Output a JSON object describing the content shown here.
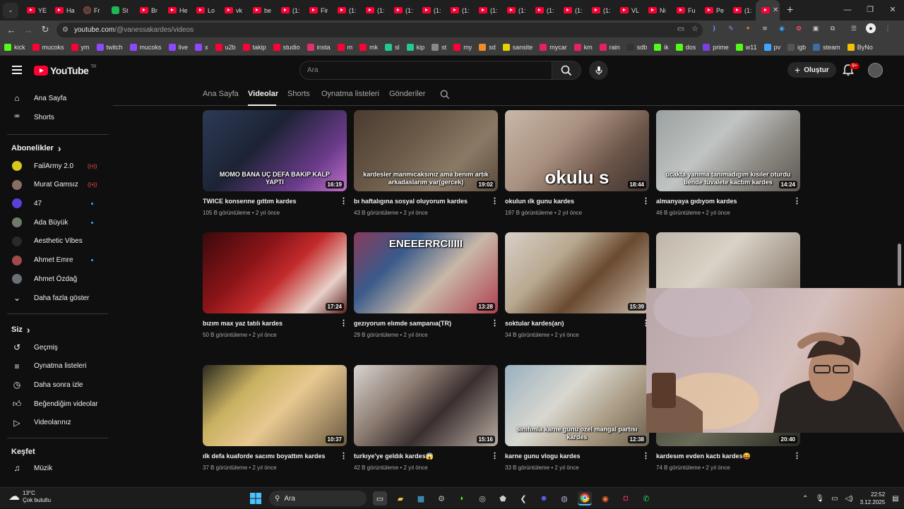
{
  "browser": {
    "tabs": [
      {
        "label": "YE",
        "icon": "youtube-favicon"
      },
      {
        "label": "Ha",
        "icon": "youtube-favicon"
      },
      {
        "label": "Fr",
        "icon": "channel-favicon"
      },
      {
        "label": "St",
        "icon": "kick-favicon"
      },
      {
        "label": "Br",
        "icon": "youtube-favicon"
      },
      {
        "label": "He",
        "icon": "youtube-favicon"
      },
      {
        "label": "Lo",
        "icon": "youtube-favicon"
      },
      {
        "label": "vk",
        "icon": "youtube-favicon"
      },
      {
        "label": "be",
        "icon": "youtube-favicon"
      },
      {
        "label": "(1:",
        "icon": "youtube-favicon"
      },
      {
        "label": "Fir",
        "icon": "youtube-favicon"
      },
      {
        "label": "(1:",
        "icon": "youtube-favicon"
      },
      {
        "label": "(1:",
        "icon": "youtube-favicon"
      },
      {
        "label": "(1:",
        "icon": "youtube-favicon"
      },
      {
        "label": "(1:",
        "icon": "youtube-favicon"
      },
      {
        "label": "(1:",
        "icon": "youtube-favicon"
      },
      {
        "label": "(1:",
        "icon": "youtube-favicon"
      },
      {
        "label": "(1:",
        "icon": "youtube-favicon"
      },
      {
        "label": "(1:",
        "icon": "youtube-favicon"
      },
      {
        "label": "(1:",
        "icon": "youtube-favicon"
      },
      {
        "label": "(1:",
        "icon": "youtube-favicon"
      },
      {
        "label": "VL",
        "icon": "youtube-favicon"
      },
      {
        "label": "Ni",
        "icon": "youtube-favicon"
      },
      {
        "label": "Fu",
        "icon": "youtube-favicon"
      },
      {
        "label": "Pe",
        "icon": "youtube-favicon"
      },
      {
        "label": "(1:",
        "icon": "youtube-favicon"
      }
    ],
    "active_tab_close": "✕",
    "new_tab": "+",
    "url_host": "youtube.com",
    "url_path": "/@vanessakardes/videos"
  },
  "bookmarks": [
    {
      "label": "kick",
      "color": "#53fc18"
    },
    {
      "label": "mucoks",
      "color": "#ff0033"
    },
    {
      "label": "ym",
      "color": "#ff0033"
    },
    {
      "label": "twitch",
      "color": "#9146ff"
    },
    {
      "label": "mucoks",
      "color": "#9146ff"
    },
    {
      "label": "live",
      "color": "#9146ff"
    },
    {
      "label": "x",
      "color": "#9146ff"
    },
    {
      "label": "u2b",
      "color": "#ff0033"
    },
    {
      "label": "takip",
      "color": "#ff0033"
    },
    {
      "label": "studio",
      "color": "#ff0033"
    },
    {
      "label": "insta",
      "color": "#e1306c"
    },
    {
      "label": "m",
      "color": "#ff0033"
    },
    {
      "label": "mk",
      "color": "#ff0033"
    },
    {
      "label": "sl",
      "color": "#20c997"
    },
    {
      "label": "kip",
      "color": "#20c997"
    },
    {
      "label": "st",
      "color": "#888888"
    },
    {
      "label": "my",
      "color": "#ff0033"
    },
    {
      "label": "sd",
      "color": "#f28c28"
    },
    {
      "label": "sansite",
      "color": "#e5d100"
    },
    {
      "label": "mycar",
      "color": "#e91e63"
    },
    {
      "label": "km",
      "color": "#e91e63"
    },
    {
      "label": "rain",
      "color": "#e91e63"
    },
    {
      "label": "sdb",
      "color": "#333333"
    },
    {
      "label": "ik",
      "color": "#53fc18"
    },
    {
      "label": "dos",
      "color": "#53fc18"
    },
    {
      "label": "prime",
      "color": "#7b3fe4"
    },
    {
      "label": "w11",
      "color": "#53fc18"
    },
    {
      "label": "pv",
      "color": "#3ea6ff"
    },
    {
      "label": "igb",
      "color": "#555555"
    },
    {
      "label": "steam",
      "color": "#3b6ea5"
    },
    {
      "label": "ByNo",
      "color": "#f2c200"
    }
  ],
  "header": {
    "logo_text": "YouTube",
    "logo_country": "TR",
    "search_placeholder": "Ara",
    "create_label": "Oluştur",
    "notif_badge": "9+"
  },
  "sidebar": {
    "main": [
      {
        "label": "Ana Sayfa",
        "icon": "home-icon"
      },
      {
        "label": "Shorts",
        "icon": "shorts-icon"
      }
    ],
    "subs_title": "Abonelikler",
    "subs": [
      {
        "label": "FailArmy 2.0",
        "status": "live",
        "avatar_color": "#d9c81c"
      },
      {
        "label": "Murat Gamsız",
        "status": "live",
        "avatar_color": "#8a6e65"
      },
      {
        "label": "47",
        "status": "new",
        "avatar_color": "#5b3fd6"
      },
      {
        "label": "Ada Büyük",
        "status": "new",
        "avatar_color": "#6f7b6a"
      },
      {
        "label": "Aesthetic Vibes",
        "status": "",
        "avatar_color": "#2a2a2a"
      },
      {
        "label": "Ahmet Emre",
        "status": "new",
        "avatar_color": "#a04a4a"
      },
      {
        "label": "Ahmet Özdağ",
        "status": "",
        "avatar_color": "#6a6f78"
      }
    ],
    "show_more": "Daha fazla göster",
    "you_title": "Siz",
    "you_items": [
      {
        "label": "Geçmiş",
        "icon": "history-icon"
      },
      {
        "label": "Oynatma listeleri",
        "icon": "playlists-icon"
      },
      {
        "label": "Daha sonra izle",
        "icon": "watch-later-icon"
      },
      {
        "label": "Beğendiğim videolar",
        "icon": "like-icon"
      },
      {
        "label": "Videolarınız",
        "icon": "your-videos-icon"
      }
    ],
    "explore_title": "Keşfet",
    "explore_items": [
      {
        "label": "Müzik",
        "icon": "music-icon"
      }
    ]
  },
  "channel_tabs": [
    "Ana Sayfa",
    "Videolar",
    "Shorts",
    "Oynatma listeleri",
    "Gönderiler"
  ],
  "channel_tab_selected": "Videolar",
  "videos": [
    {
      "title": "TWICE konserıne gıttım kardes",
      "views": "105 B görüntüleme",
      "age": "2 yıl önce",
      "duration": "16:19",
      "overlay": "MOMO BANA UÇ DEFA BAKIP KALP YAPTI",
      "bg": "linear-gradient(135deg,#2c3a55 0%,#1d2335 40%,#6a3b8a 75%,#c06fc8 100%)"
    },
    {
      "title": "bı haftalıgına sosyal oluyorum kardes",
      "views": "43 B görüntüleme",
      "age": "2 yıl önce",
      "duration": "19:02",
      "overlay": "kardesler manmıcaksınız ama benım artık arkadaslarım var(gercek)",
      "bg": "linear-gradient(135deg,#4a3b30 0%,#6b5a48 40%,#8a7a65 70%,#5a4a3d 100%)"
    },
    {
      "title": "okulun ılk gunu kardes",
      "views": "197 B görüntüleme",
      "age": "2 yıl önce",
      "duration": "18:44",
      "overlay": "okulu s",
      "bg": "linear-gradient(135deg,#c9b8a8 0%,#a89080 40%,#6b5548 70%,#3d3330 100%)"
    },
    {
      "title": "almanyaya gıdıyom kardes",
      "views": "46 B görüntüleme",
      "age": "2 yıl önce",
      "duration": "14:24",
      "overlay": "ucakta yanıma tanımadıgım kısıler oturdu bende tuvalete kactım kardes",
      "bg": "linear-gradient(135deg,#9aa0a0 0%,#c0c4c2 40%,#8a8680 70%,#5e5852 100%)"
    },
    {
      "title": "bızım max yaz tatılı kardes",
      "views": "50 B görüntüleme",
      "age": "2 yıl önce",
      "duration": "17:24",
      "overlay": "",
      "bg": "linear-gradient(135deg,#3a0a0c 0%,#8a1418 35%,#c22a2a 55%,#e8d0c8 80%,#5a2020 100%)"
    },
    {
      "title": "gezıyorum elımde sampanıa(TR)",
      "views": "29 B görüntüleme",
      "age": "2 yıl önce",
      "duration": "13:28",
      "overlay": "ENEEERRCIIIII",
      "bg": "linear-gradient(135deg,#8a3a5a 0%,#3a5a8a 30%,#c8b8a8 60%,#b04050 100%)"
    },
    {
      "title": "soktular kardes(arı)",
      "views": "34 B görüntüleme",
      "age": "2 yıl önce",
      "duration": "15:39",
      "overlay": "",
      "bg": "linear-gradient(135deg,#d8d0c8 0%,#b8a890 35%,#6a4a30 60%,#c8b8a8 100%)"
    },
    {
      "title": "",
      "views": "",
      "age": "",
      "duration": "",
      "overlay": "",
      "bg": "linear-gradient(135deg,#bfb6a8 0%,#d9d2c6 40%,#9a8d80 80%,#7a6a60 100%)"
    },
    {
      "title": "ılk defa kuaforde sacımı boyattım kardes",
      "views": "37 B görüntüleme",
      "age": "2 yıl önce",
      "duration": "10:37",
      "overlay": "",
      "bg": "linear-gradient(135deg,#2a2a20 0%,#c8b060 30%,#e8c890 55%,#6a5a40 100%)"
    },
    {
      "title": "turkıye'ye geldık kardes😱",
      "views": "42 B görüntüleme",
      "age": "2 yıl önce",
      "duration": "15:16",
      "overlay": "",
      "bg": "linear-gradient(135deg,#d8d4d0 0%,#8a7a70 35%,#3a3030 60%,#b8aaa0 100%)"
    },
    {
      "title": "karne gunu vlogu kardes",
      "views": "33 B görüntüleme",
      "age": "2 yıl önce",
      "duration": "12:38",
      "overlay": "sınıfımla karne gunu ozel mangal partısı kardes",
      "bg": "linear-gradient(135deg,#9ab0c0 0%,#d8d8d0 40%,#a89880 70%,#6a6050 100%)"
    },
    {
      "title": "kardesım evden kactı kardes😝",
      "views": "74 B görüntüleme",
      "age": "2 yıl önce",
      "duration": "20:40",
      "overlay": "",
      "bg": "linear-gradient(135deg,#3a3a30 0%,#6a6a58 50%,#2a2a22 100%)"
    }
  ],
  "taskbar": {
    "temp": "13°C",
    "weather": "Çok bulutlu",
    "search": "Ara",
    "time": "22:52",
    "date": "3.12.2025"
  }
}
